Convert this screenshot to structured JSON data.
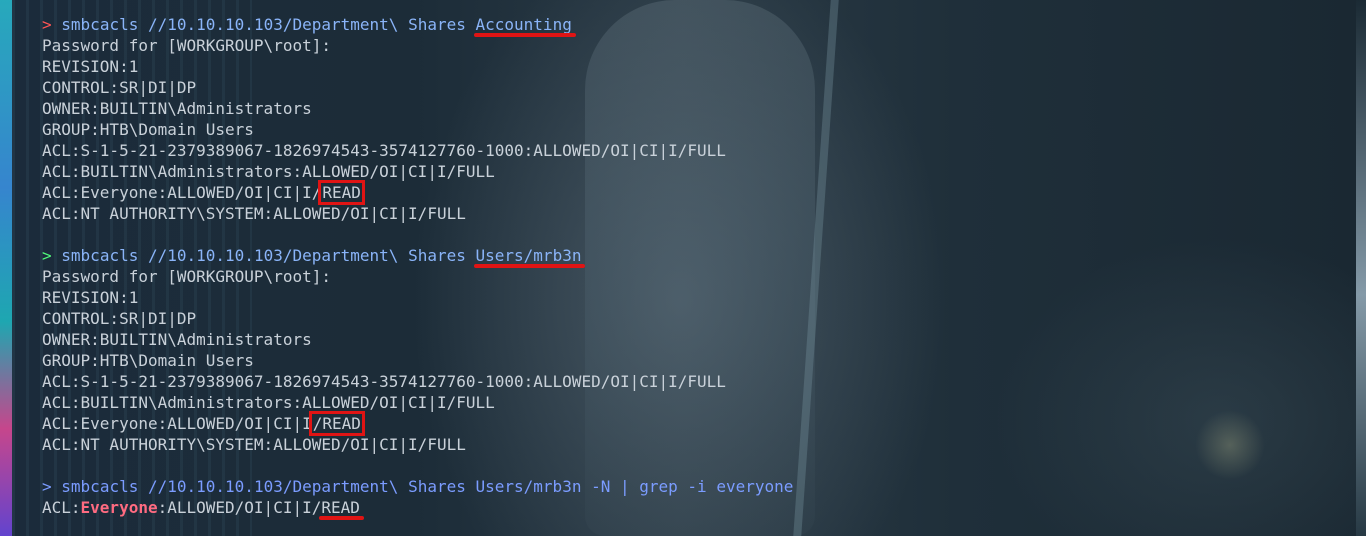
{
  "colors": {
    "prompt_error": "#ff5555",
    "prompt_ok": "#50fa7b",
    "command": "#8ab4f8",
    "output": "#c9d1d9",
    "highlight": "#e01414",
    "grep_match": "#ff6b81"
  },
  "blocks": [
    {
      "prompt": ">",
      "command_prefix": "smbcacls //10.10.10.103/Department\\ Shares ",
      "command_target": "Accounting",
      "output": [
        "Password for [WORKGROUP\\root]:",
        "REVISION:1",
        "CONTROL:SR|DI|DP",
        "OWNER:BUILTIN\\Administrators",
        "GROUP:HTB\\Domain Users",
        "ACL:S-1-5-21-2379389067-1826974543-3574127760-1000:ALLOWED/OI|CI|I/FULL",
        "ACL:BUILTIN\\Administrators:ALLOWED/OI|CI|I/FULL"
      ],
      "everyone_prefix": "ACL:Everyone:ALLOWED/OI|CI|I/",
      "everyone_perm": "READ",
      "last_line": "ACL:NT AUTHORITY\\SYSTEM:ALLOWED/OI|CI|I/FULL"
    },
    {
      "prompt": ">",
      "command_prefix": "smbcacls //10.10.10.103/Department\\ Shares ",
      "command_target": "Users/mrb3n",
      "output": [
        "Password for [WORKGROUP\\root]:",
        "REVISION:1",
        "CONTROL:SR|DI|DP",
        "OWNER:BUILTIN\\Administrators",
        "GROUP:HTB\\Domain Users",
        "ACL:S-1-5-21-2379389067-1826974543-3574127760-1000:ALLOWED/OI|CI|I/FULL",
        "ACL:BUILTIN\\Administrators:ALLOWED/OI|CI|I/FULL"
      ],
      "everyone_prefix": "ACL:Everyone:ALLOWED/OI|CI|I",
      "everyone_perm": "/READ",
      "last_line": "ACL:NT AUTHORITY\\SYSTEM:ALLOWED/OI|CI|I/FULL"
    },
    {
      "prompt": ">",
      "command": "smbcacls //10.10.10.103/Department\\ Shares Users/mrb3n -N | grep -i everyone",
      "result_prefix": "ACL:",
      "result_match": "Everyone",
      "result_mid": ":ALLOWED/OI|CI|I/",
      "result_perm": "READ"
    }
  ]
}
